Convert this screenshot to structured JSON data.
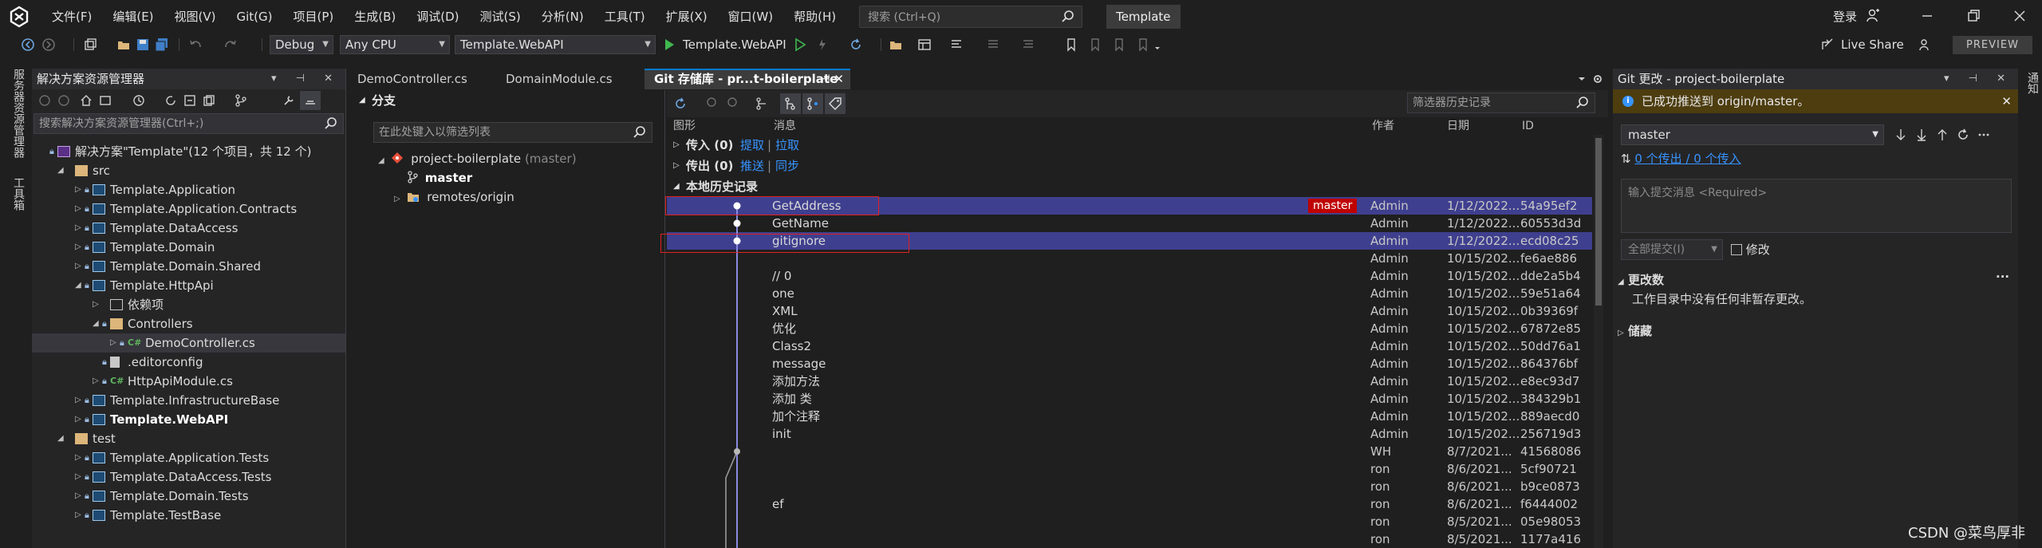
{
  "menu": {
    "items": [
      "文件(F)",
      "编辑(E)",
      "视图(V)",
      "Git(G)",
      "项目(P)",
      "生成(B)",
      "调试(D)",
      "测试(S)",
      "分析(N)",
      "工具(T)",
      "扩展(X)",
      "窗口(W)",
      "帮助(H)"
    ],
    "search_placeholder": "搜索 (Ctrl+Q)",
    "solution_name": "Template",
    "login": "登录"
  },
  "toolbar": {
    "config": "Debug",
    "platform": "Any CPU",
    "startup_project": "Template.WebAPI",
    "run_label": "Template.WebAPI",
    "live_share": "Live Share",
    "preview": "PREVIEW"
  },
  "left_strip": {
    "tabs": [
      "服务器资源管理器",
      "工具箱"
    ]
  },
  "solution_explorer": {
    "title": "解决方案资源管理器",
    "search_placeholder": "搜索解决方案资源管理器(Ctrl+;)",
    "tree": [
      {
        "label": "解决方案\"Template\"(12 个项目，共 12 个)",
        "depth": 0,
        "icon": "solution",
        "expander": "",
        "lock": true
      },
      {
        "label": "src",
        "depth": 1,
        "icon": "folder",
        "expander": "open",
        "lock": false
      },
      {
        "label": "Template.Application",
        "depth": 2,
        "icon": "project",
        "expander": "closed",
        "lock": true
      },
      {
        "label": "Template.Application.Contracts",
        "depth": 2,
        "icon": "project",
        "expander": "closed",
        "lock": true
      },
      {
        "label": "Template.DataAccess",
        "depth": 2,
        "icon": "project",
        "expander": "closed",
        "lock": true
      },
      {
        "label": "Template.Domain",
        "depth": 2,
        "icon": "project",
        "expander": "closed",
        "lock": true
      },
      {
        "label": "Template.Domain.Shared",
        "depth": 2,
        "icon": "project",
        "expander": "closed",
        "lock": true
      },
      {
        "label": "Template.HttpApi",
        "depth": 2,
        "icon": "project",
        "expander": "open",
        "lock": true
      },
      {
        "label": "依赖项",
        "depth": 3,
        "icon": "deps",
        "expander": "closed",
        "lock": false
      },
      {
        "label": "Controllers",
        "depth": 3,
        "icon": "folder",
        "expander": "open",
        "lock": true
      },
      {
        "label": "DemoController.cs",
        "depth": 4,
        "icon": "cs",
        "expander": "closed",
        "lock": true
      },
      {
        "label": ".editorconfig",
        "depth": 3,
        "icon": "file",
        "expander": "",
        "lock": true
      },
      {
        "label": "HttpApiModule.cs",
        "depth": 3,
        "icon": "cs",
        "expander": "closed",
        "lock": true
      },
      {
        "label": "Template.InfrastructureBase",
        "depth": 2,
        "icon": "project",
        "expander": "closed",
        "lock": true
      },
      {
        "label": "Template.WebAPI",
        "depth": 2,
        "icon": "project",
        "expander": "closed",
        "lock": true
      },
      {
        "label": "test",
        "depth": 1,
        "icon": "folder",
        "expander": "open",
        "lock": false
      },
      {
        "label": "Template.Application.Tests",
        "depth": 2,
        "icon": "project",
        "expander": "closed",
        "lock": true
      },
      {
        "label": "Template.DataAccess.Tests",
        "depth": 2,
        "icon": "project",
        "expander": "closed",
        "lock": true
      },
      {
        "label": "Template.Domain.Tests",
        "depth": 2,
        "icon": "project",
        "expander": "closed",
        "lock": true
      },
      {
        "label": "Template.TestBase",
        "depth": 2,
        "icon": "project",
        "expander": "closed",
        "lock": true
      }
    ]
  },
  "tabs": [
    {
      "label": "DemoController.cs"
    },
    {
      "label": "DomainModule.cs"
    },
    {
      "label": "Git 存储库 - pr...t-boilerplate"
    }
  ],
  "branches": {
    "header": "分支",
    "filter_placeholder": "在此处键入以筛选列表",
    "repo": "project-boilerplate",
    "repo_branch": "(master)",
    "local_branch": "master",
    "remote": "remotes/origin"
  },
  "history": {
    "filter_placeholder": "筛选器历史记录",
    "columns": {
      "graph": "图形",
      "message": "消息",
      "author": "作者",
      "date": "日期",
      "id": "ID"
    },
    "incoming": {
      "label": "传入 (0)",
      "fetch": "提取",
      "sep": "|",
      "pull": "拉取"
    },
    "outgoing": {
      "label": "传出 (0)",
      "push": "推送",
      "sep": "|",
      "sync": "同步"
    },
    "local_header": "本地历史记录",
    "commits": [
      {
        "message": "GetAddress",
        "tag": "master",
        "author": "Admin",
        "date": "1/12/2022...",
        "id": "54a95ef2",
        "selected": true
      },
      {
        "message": "GetName",
        "tag": "",
        "author": "Admin",
        "date": "1/12/2022...",
        "id": "60553d3d",
        "selected": false
      },
      {
        "message": "gitignore",
        "tag": "",
        "author": "Admin",
        "date": "1/12/2022...",
        "id": "ecd08c25",
        "selected": true
      },
      {
        "message": "",
        "tag": "",
        "author": "Admin",
        "date": "10/15/202...",
        "id": "fe6ae886",
        "selected": false
      },
      {
        "message": "// 0",
        "tag": "",
        "author": "Admin",
        "date": "10/15/202...",
        "id": "dde2a5b4",
        "selected": false
      },
      {
        "message": "one",
        "tag": "",
        "author": "Admin",
        "date": "10/15/202...",
        "id": "59e51a64",
        "selected": false
      },
      {
        "message": "XML",
        "tag": "",
        "author": "Admin",
        "date": "10/15/202...",
        "id": "0b39369f",
        "selected": false
      },
      {
        "message": "优化",
        "tag": "",
        "author": "Admin",
        "date": "10/15/202...",
        "id": "67872e85",
        "selected": false
      },
      {
        "message": "Class2",
        "tag": "",
        "author": "Admin",
        "date": "10/15/202...",
        "id": "50dd76a1",
        "selected": false
      },
      {
        "message": "message",
        "tag": "",
        "author": "Admin",
        "date": "10/15/202...",
        "id": "864376bf",
        "selected": false
      },
      {
        "message": "添加方法",
        "tag": "",
        "author": "Admin",
        "date": "10/15/202...",
        "id": "e8ec93d7",
        "selected": false
      },
      {
        "message": "添加 类",
        "tag": "",
        "author": "Admin",
        "date": "10/15/202...",
        "id": "384329b1",
        "selected": false
      },
      {
        "message": "加个注释",
        "tag": "",
        "author": "Admin",
        "date": "10/15/202...",
        "id": "889aecd0",
        "selected": false
      },
      {
        "message": "init",
        "tag": "",
        "author": "Admin",
        "date": "10/15/202...",
        "id": "256719d3",
        "selected": false
      },
      {
        "message": "",
        "tag": "",
        "author": "WH",
        "date": "8/7/2021...",
        "id": "41568086",
        "selected": false
      },
      {
        "message": "",
        "tag": "",
        "author": "ron",
        "date": "8/6/2021...",
        "id": "5cf90721",
        "selected": false
      },
      {
        "message": "",
        "tag": "",
        "author": "ron",
        "date": "8/6/2021...",
        "id": "b9ce0873",
        "selected": false
      },
      {
        "message": "ef",
        "tag": "",
        "author": "ron",
        "date": "8/6/2021...",
        "id": "f6444002",
        "selected": false
      },
      {
        "message": "",
        "tag": "",
        "author": "ron",
        "date": "8/5/2021...",
        "id": "05e98053",
        "selected": false
      },
      {
        "message": "",
        "tag": "",
        "author": "ron",
        "date": "8/5/2021...",
        "id": "1177a416",
        "selected": false
      }
    ]
  },
  "git_changes": {
    "title": "Git 更改 - project-boilerplate",
    "banner": "已成功推送到 origin/master。",
    "branch": "master",
    "out_in": "0 个传出 / 0 个传入",
    "commit_placeholder": "输入提交消息 <Required>",
    "commit_all": "全部提交(I)",
    "amend": "修改",
    "changes_header": "更改数",
    "changes_empty": "工作目录中没有任何非暂存更改。",
    "stash_header": "储藏",
    "more": "..."
  },
  "right_strip": {
    "tabs": [
      "通知"
    ]
  },
  "watermark": "CSDN @菜鸟厚非",
  "colors": {
    "accent": "#007acc",
    "selection": "#3f3f8f",
    "tag": "#c00000",
    "banner": "#4d3d0f",
    "link": "#3794ff"
  }
}
